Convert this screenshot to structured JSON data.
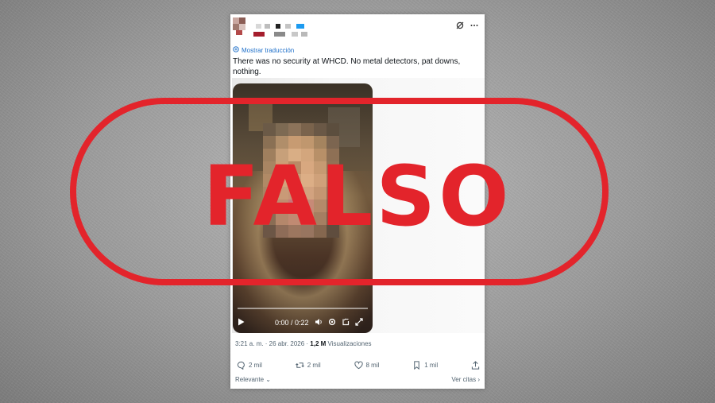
{
  "tweet": {
    "translate_label": "Mostrar traducción",
    "text": "There was no security at WHCD. No metal detectors, pat downs, nothing.",
    "timestamp": "3:21 a. m. · 26 abr. 2026 ·",
    "views_count": "1,2 M",
    "views_label": "Visualizaciones"
  },
  "video": {
    "time": "0:00 / 0:22",
    "progress_fraction": 0
  },
  "actions": {
    "replies": "2 mil",
    "reposts": "2 mil",
    "likes": "8 mil",
    "bookmarks": "1 mil"
  },
  "footer": {
    "sort_label": "Relevante",
    "quotes_label": "Ver citas"
  },
  "stamp": {
    "text": "FALSO",
    "color": "#e3242b"
  },
  "icons": [
    "grok-icon",
    "more-icon",
    "translate-icon",
    "play-icon",
    "volume-icon",
    "settings-icon",
    "pip-icon",
    "fullscreen-icon",
    "reply-icon",
    "repost-icon",
    "like-icon",
    "bookmark-icon",
    "share-icon"
  ]
}
